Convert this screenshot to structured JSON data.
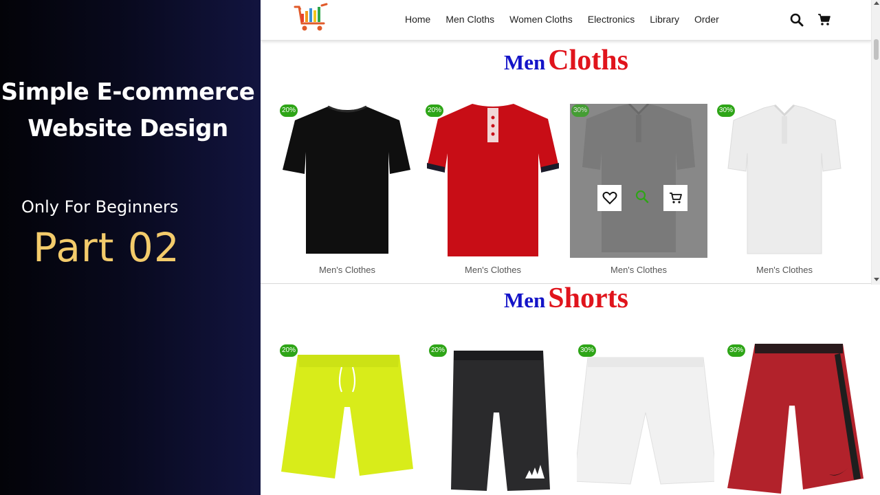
{
  "promo": {
    "title_line1": "Simple E-commerce",
    "title_line2": "Website Design",
    "subtitle": "Only For Beginners",
    "part": "Part 02"
  },
  "nav": {
    "links": [
      "Home",
      "Men Cloths",
      "Women Cloths",
      "Electronics",
      "Library",
      "Order"
    ],
    "icons": [
      "search-icon",
      "cart-icon"
    ]
  },
  "sections": [
    {
      "heading_small": "Men",
      "heading_big": "Cloths",
      "products": [
        {
          "badge": "20%",
          "label": "Men's Clothes",
          "image": "black-tshirt"
        },
        {
          "badge": "20%",
          "label": "Men's Clothes",
          "image": "red-henley-tshirt"
        },
        {
          "badge": "30%",
          "label": "Men's Clothes",
          "image": "grey-polo-shirt",
          "hovered": true
        },
        {
          "badge": "30%",
          "label": "Men's Clothes",
          "image": "white-polo-shirt"
        }
      ]
    },
    {
      "heading_small": "Men",
      "heading_big": "Shorts",
      "products": [
        {
          "badge": "20%",
          "image": "yellow-shorts"
        },
        {
          "badge": "20%",
          "image": "black-adidas-shorts"
        },
        {
          "badge": "30%",
          "image": "white-shorts"
        },
        {
          "badge": "30%",
          "image": "red-nike-shorts"
        }
      ]
    }
  ],
  "hover_actions": [
    "heart-icon",
    "search-icon",
    "cart-icon"
  ],
  "colors": {
    "badge": "#2ea517",
    "heading_small": "#1414c8",
    "heading_big": "#e0141c",
    "promo_accent": "#f3cb6b",
    "promo_bg": "#12143f"
  }
}
